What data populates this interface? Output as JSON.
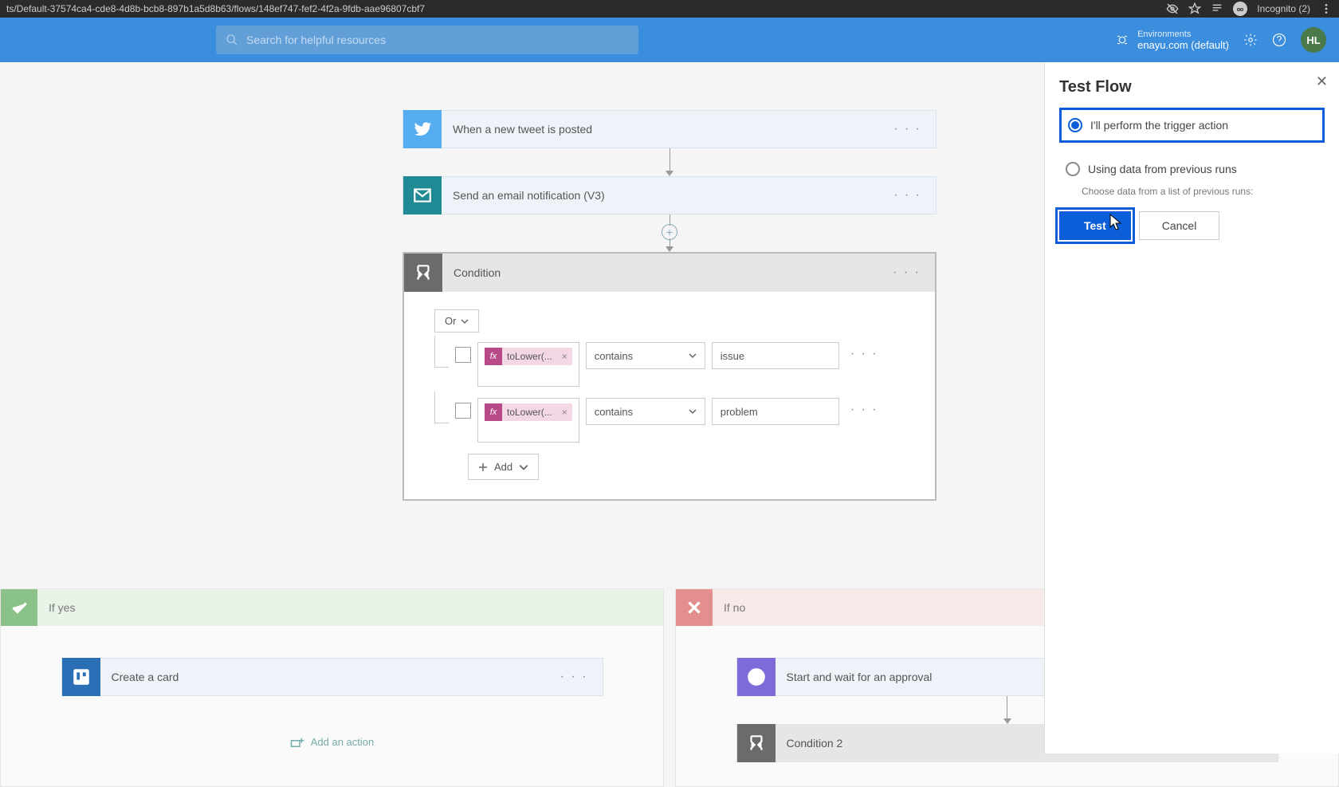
{
  "browser": {
    "url": "ts/Default-37574ca4-cde8-4d8b-bcb8-897b1a5d8b63/flows/148ef747-fef2-4f2a-9fdb-aae96807cbf7",
    "incognito": "Incognito (2)"
  },
  "topbar": {
    "search_placeholder": "Search for helpful resources",
    "env_label": "Environments",
    "env_name": "enayu.com (default)",
    "avatar": "HL"
  },
  "flow": {
    "trigger": {
      "title": "When a new tweet is posted"
    },
    "email": {
      "title": "Send an email notification (V3)"
    },
    "condition": {
      "title": "Condition",
      "group_op": "Or",
      "rows": [
        {
          "expr": "toLower(...",
          "op": "contains",
          "val": "issue"
        },
        {
          "expr": "toLower(...",
          "op": "contains",
          "val": "problem"
        }
      ],
      "add_label": "Add"
    },
    "yes": {
      "label": "If yes",
      "action": "Create a card",
      "add_action": "Add an action"
    },
    "no": {
      "label": "If no",
      "action1": "Start and wait for an approval",
      "action2": "Condition 2"
    }
  },
  "panel": {
    "title": "Test Flow",
    "opt1": "I'll perform the trigger action",
    "opt2": "Using data from previous runs",
    "hint": "Choose data from a list of previous runs:",
    "test": "Test",
    "cancel": "Cancel"
  }
}
